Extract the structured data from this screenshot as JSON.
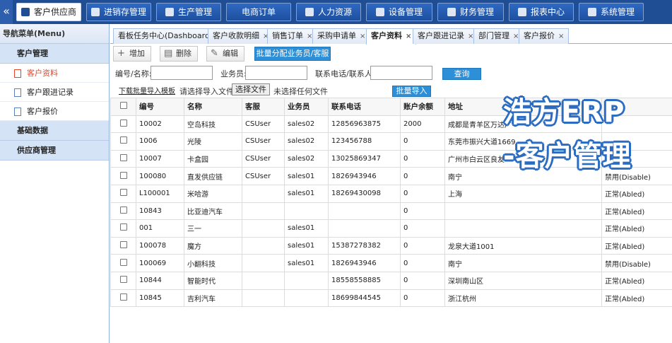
{
  "top_nav": {
    "collapse_icon": "«",
    "items": [
      {
        "label": "客户供应商",
        "icon": "users-icon"
      },
      {
        "label": "进销存管理",
        "icon": "inventory-icon"
      },
      {
        "label": "生产管理",
        "icon": "factory-icon"
      },
      {
        "label": "电商订单",
        "icon": ""
      },
      {
        "label": "人力资源",
        "icon": "person-icon"
      },
      {
        "label": "设备管理",
        "icon": "monitor-icon"
      },
      {
        "label": "财务管理",
        "icon": "finance-icon"
      },
      {
        "label": "报表中心",
        "icon": "report-icon"
      },
      {
        "label": "系统管理",
        "icon": "system-icon"
      }
    ],
    "active_index": 0
  },
  "sidebar": {
    "title": "导航菜单(Menu)",
    "group_customer": "客户管理",
    "items": [
      {
        "label": "客户资料",
        "icon": "document-icon"
      },
      {
        "label": "客户跟进记录",
        "icon": "document-icon"
      },
      {
        "label": "客户报价",
        "icon": "document-icon"
      }
    ],
    "group_basic": "基础数据",
    "group_supplier": "供应商管理"
  },
  "tabs": [
    {
      "label": "看板任务中心(Dashboard)"
    },
    {
      "label": "客户收款明细"
    },
    {
      "label": "销售订单"
    },
    {
      "label": "采购申请单"
    },
    {
      "label": "客户资料"
    },
    {
      "label": "客户跟进记录"
    },
    {
      "label": "部门管理"
    },
    {
      "label": "客户报价"
    }
  ],
  "tab_close": "×",
  "toolbar": {
    "add": "增加",
    "delete": "删除",
    "edit": "编辑",
    "batch_assign": "批量分配业务员/客服"
  },
  "search": {
    "code_name_label": "编号/名称:",
    "code_name_value": "",
    "salesman_label": "业务员:",
    "salesman_value": "",
    "contact_label": "联系电话/联系人:",
    "contact_value": "",
    "query_button": "查询",
    "download_template": "下载批量导入模板",
    "choose_file_label": "请选择导入文件:",
    "choose_file_button": "选择文件",
    "no_file_text": "未选择任何文件",
    "batch_import": "批量导入"
  },
  "table": {
    "headers": [
      "编号",
      "名称",
      "客服",
      "业务员",
      "联系电话",
      "账户余额",
      "地址",
      ""
    ],
    "rows": [
      [
        "10002",
        "空岛科技",
        "CSUser",
        "sales02",
        "12856963875",
        "2000",
        "成都是青羊区万达广",
        ""
      ],
      [
        "1006",
        "光陵",
        "CSUser",
        "sales02",
        "123456788",
        "0",
        "东莞市振兴大道1669",
        ""
      ],
      [
        "10007",
        "卡盒园",
        "CSUser",
        "sales02",
        "13025869347",
        "0",
        "广州市白云区良友",
        ""
      ],
      [
        "100080",
        "直发供应链",
        "CSUser",
        "sales01",
        "1826943946",
        "0",
        "南宁",
        "禁用(Disable)"
      ],
      [
        "L100001",
        "米哈游",
        "",
        "sales01",
        "18269430098",
        "0",
        "上海",
        "正常(Abled)"
      ],
      [
        "10843",
        "比亚迪汽车",
        "",
        "",
        "",
        "0",
        "",
        "正常(Abled)"
      ],
      [
        "001",
        "三一",
        "",
        "sales01",
        "",
        "0",
        "",
        "正常(Abled)"
      ],
      [
        "100078",
        "魔方",
        "",
        "sales01",
        "15387278382",
        "0",
        "龙泉大道1001",
        "正常(Abled)"
      ],
      [
        "100069",
        "小翻科技",
        "",
        "sales01",
        "1826943946",
        "0",
        "南宁",
        "禁用(Disable)"
      ],
      [
        "10844",
        "智能时代",
        "",
        "",
        "18558558885",
        "0",
        "深圳南山区",
        "正常(Abled)"
      ],
      [
        "10845",
        "吉利汽车",
        "",
        "",
        "18699844545",
        "0",
        "浙江杭州",
        "正常(Abled)"
      ]
    ]
  },
  "watermark": {
    "line1": "浩方ERP",
    "line2": "-客户管理"
  },
  "colors": {
    "nav_blue": "#1f4e95",
    "button_blue": "#2c8fd7",
    "active_red": "#e2462c"
  }
}
